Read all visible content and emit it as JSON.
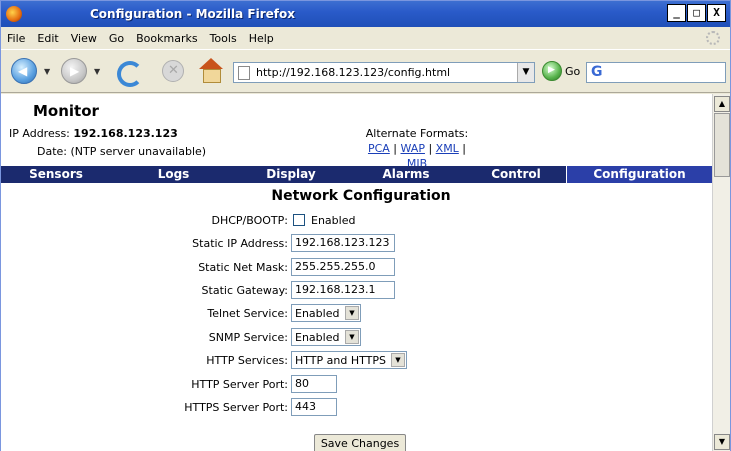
{
  "window": {
    "title": "Configuration - Mozilla Firefox",
    "controls": [
      "_",
      "□",
      "X"
    ]
  },
  "menu": [
    "File",
    "Edit",
    "View",
    "Go",
    "Bookmarks",
    "Tools",
    "Help"
  ],
  "toolbar": {
    "url": "http://192.168.123.123/config.html",
    "go_label": "Go",
    "search_icon_label": "G"
  },
  "header": {
    "title": "Monitor",
    "ip_label": "IP Address:",
    "ip_value": "192.168.123.123",
    "date_label": "Date:",
    "date_value": "(NTP server unavailable)",
    "alt_formats_label": "Alternate Formats:",
    "alt_links": [
      "PCA",
      "WAP",
      "XML",
      "MIB"
    ],
    "alt_separator": " | "
  },
  "tabs": [
    "Sensors",
    "Logs",
    "Display",
    "Alarms",
    "Control",
    "Configuration"
  ],
  "active_tab": "Configuration",
  "form": {
    "title": "Network Configuration",
    "dhcp_label": "DHCP/BOOTP:",
    "dhcp_checkbox_label": "Enabled",
    "static_ip_label": "Static IP Address:",
    "static_ip_value": "192.168.123.123",
    "netmask_label": "Static Net Mask:",
    "netmask_value": "255.255.255.0",
    "gateway_label": "Static Gateway:",
    "gateway_value": "192.168.123.1",
    "telnet_label": "Telnet Service:",
    "telnet_value": "Enabled",
    "snmp_label": "SNMP Service:",
    "snmp_value": "Enabled",
    "http_services_label": "HTTP Services:",
    "http_services_value": "HTTP and HTTPS",
    "http_port_label": "HTTP Server Port:",
    "http_port_value": "80",
    "https_port_label": "HTTPS Server Port:",
    "https_port_value": "443",
    "save_label": "Save Changes"
  },
  "colors": {
    "tab_bar": "#1b2a6e",
    "tab_active": "#2b3fa8",
    "title_bar": "#2a5bc9",
    "link": "#1a3fb8"
  }
}
